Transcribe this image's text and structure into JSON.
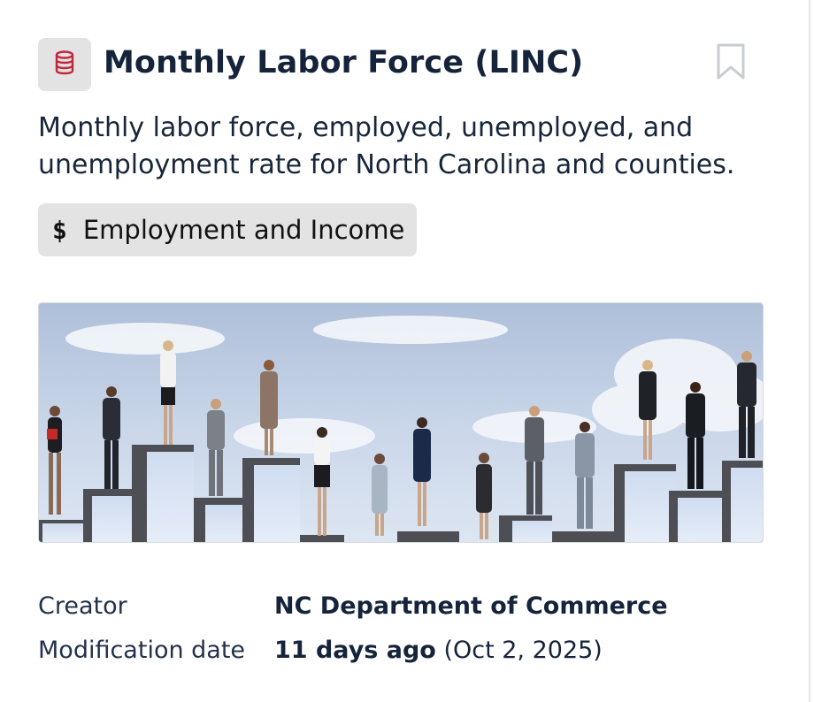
{
  "dataset": {
    "type_icon": "database-icon",
    "title": "Monthly Labor Force (LINC)",
    "bookmark_icon": "bookmark-icon",
    "description": "Monthly labor force, employed, unemployed, and unemployment rate for North Carolina and counties.",
    "tag": {
      "icon": "$",
      "label": "Employment and Income"
    },
    "hero_image": "people-standing-on-rising-steps-photo",
    "metadata": {
      "creator_label": "Creator",
      "creator_value": "NC Department of Commerce",
      "modified_label": "Modification date",
      "modified_relative": "11 days ago",
      "modified_absolute": "(Oct 2, 2025)"
    }
  },
  "colors": {
    "text": "#15243a",
    "badge_bg": "#e3e3e3",
    "database_icon": "#c0273a",
    "bookmark_stroke": "#c9ccd1"
  }
}
